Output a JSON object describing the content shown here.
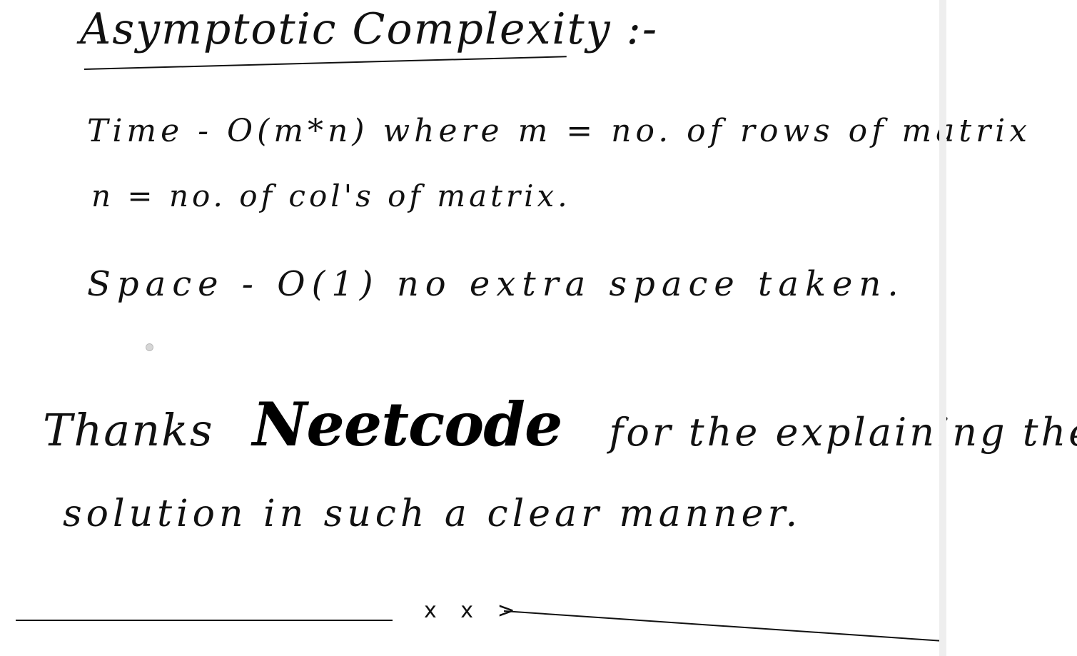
{
  "note": {
    "title": "Asymptotic Complexity :-",
    "lines": [
      "Time - O(m*n) where m = no. of rows of matrix",
      "n = no. of col's of matrix.",
      "Space - O(1) no extra space taken."
    ],
    "thanks": {
      "prefix": "Thanks",
      "signature": "Neetcode",
      "suffix": "for the explaining the"
    },
    "closing_line": "solution in such a clear manner.",
    "footer_marks": "x x >"
  }
}
